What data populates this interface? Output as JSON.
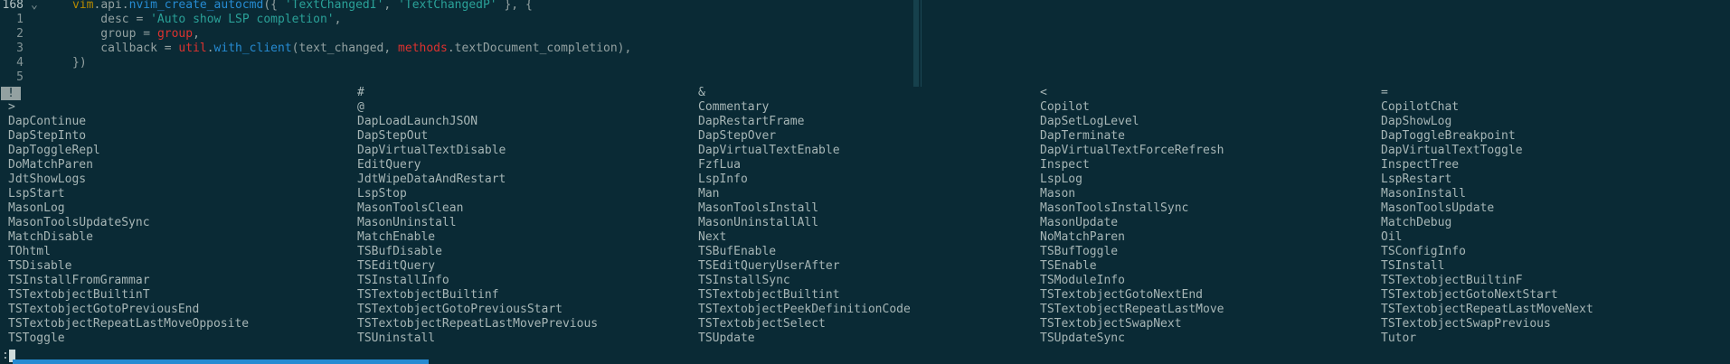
{
  "editor": {
    "lines": [
      {
        "num": "168",
        "fold": "⌄",
        "segments": [
          {
            "t": "vim",
            "c": "var"
          },
          {
            "t": ".",
            "c": "plain"
          },
          {
            "t": "api",
            "c": "plain"
          },
          {
            "t": ".",
            "c": "plain"
          },
          {
            "t": "nvim_create_autocmd",
            "c": "fn"
          },
          {
            "t": "({ ",
            "c": "plain"
          },
          {
            "t": "'TextChangedI'",
            "c": "str"
          },
          {
            "t": ", ",
            "c": "plain"
          },
          {
            "t": "'TextChangedP'",
            "c": "str"
          },
          {
            "t": " }, {",
            "c": "plain"
          }
        ]
      },
      {
        "num": "1",
        "fold": "",
        "segments": [
          {
            "t": "    desc ",
            "c": "plain"
          },
          {
            "t": "=",
            "c": "plain"
          },
          {
            "t": " ",
            "c": "plain"
          },
          {
            "t": "'Auto show LSP completion'",
            "c": "str"
          },
          {
            "t": ",",
            "c": "plain"
          }
        ]
      },
      {
        "num": "2",
        "fold": "",
        "segments": [
          {
            "t": "    group ",
            "c": "plain"
          },
          {
            "t": "=",
            "c": "plain"
          },
          {
            "t": " ",
            "c": "plain"
          },
          {
            "t": "group",
            "c": "kw"
          },
          {
            "t": ",",
            "c": "plain"
          }
        ]
      },
      {
        "num": "3",
        "fold": "",
        "segments": [
          {
            "t": "    callback ",
            "c": "plain"
          },
          {
            "t": "=",
            "c": "plain"
          },
          {
            "t": " ",
            "c": "plain"
          },
          {
            "t": "util",
            "c": "kw"
          },
          {
            "t": ".",
            "c": "plain"
          },
          {
            "t": "with_client",
            "c": "fn"
          },
          {
            "t": "(text_changed, ",
            "c": "plain"
          },
          {
            "t": "methods",
            "c": "kw"
          },
          {
            "t": ".textDocument_completion),",
            "c": "plain"
          }
        ]
      },
      {
        "num": "4",
        "fold": "",
        "segments": [
          {
            "t": "})",
            "c": "plain"
          }
        ]
      },
      {
        "num": "5",
        "fold": "",
        "segments": []
      }
    ]
  },
  "completion": {
    "first_item": "!",
    "rows": [
      [
        "",
        "#",
        "&",
        "<",
        "="
      ],
      [
        ">",
        "@",
        "Commentary",
        "Copilot",
        "CopilotChat"
      ],
      [
        "DapContinue",
        "DapLoadLaunchJSON",
        "DapRestartFrame",
        "DapSetLogLevel",
        "DapShowLog"
      ],
      [
        "DapStepInto",
        "DapStepOut",
        "DapStepOver",
        "DapTerminate",
        "DapToggleBreakpoint"
      ],
      [
        "DapToggleRepl",
        "DapVirtualTextDisable",
        "DapVirtualTextEnable",
        "DapVirtualTextForceRefresh",
        "DapVirtualTextToggle"
      ],
      [
        "DoMatchParen",
        "EditQuery",
        "FzfLua",
        "Inspect",
        "InspectTree"
      ],
      [
        "JdtShowLogs",
        "JdtWipeDataAndRestart",
        "LspInfo",
        "LspLog",
        "LspRestart"
      ],
      [
        "LspStart",
        "LspStop",
        "Man",
        "Mason",
        "MasonInstall"
      ],
      [
        "MasonLog",
        "MasonToolsClean",
        "MasonToolsInstall",
        "MasonToolsInstallSync",
        "MasonToolsUpdate"
      ],
      [
        "MasonToolsUpdateSync",
        "MasonUninstall",
        "MasonUninstallAll",
        "MasonUpdate",
        "MatchDebug"
      ],
      [
        "MatchDisable",
        "MatchEnable",
        "Next",
        "NoMatchParen",
        "Oil"
      ],
      [
        "TOhtml",
        "TSBufDisable",
        "TSBufEnable",
        "TSBufToggle",
        "TSConfigInfo"
      ],
      [
        "TSDisable",
        "TSEditQuery",
        "TSEditQueryUserAfter",
        "TSEnable",
        "TSInstall"
      ],
      [
        "TSInstallFromGrammar",
        "TSInstallInfo",
        "TSInstallSync",
        "TSModuleInfo",
        "TSTextobjectBuiltinF"
      ],
      [
        "TSTextobjectBuiltinT",
        "TSTextobjectBuiltinf",
        "TSTextobjectBuiltint",
        "TSTextobjectGotoNextEnd",
        "TSTextobjectGotoNextStart"
      ],
      [
        "TSTextobjectGotoPreviousEnd",
        "TSTextobjectGotoPreviousStart",
        "TSTextobjectPeekDefinitionCode",
        "TSTextobjectRepeatLastMove",
        "TSTextobjectRepeatLastMoveNext"
      ],
      [
        "TSTextobjectRepeatLastMoveOpposite",
        "TSTextobjectRepeatLastMovePrevious",
        "TSTextobjectSelect",
        "TSTextobjectSwapNext",
        "TSTextobjectSwapPrevious"
      ],
      [
        "TSToggle",
        "TSUninstall",
        "TSUpdate",
        "TSUpdateSync",
        "Tutor"
      ]
    ]
  },
  "cmdline": {
    "prompt": ":"
  },
  "colors": {
    "background": "#0a2a35",
    "string": "#2aa198",
    "function": "#268bd2",
    "keyword": "#dc322f",
    "variable": "#b58900"
  }
}
